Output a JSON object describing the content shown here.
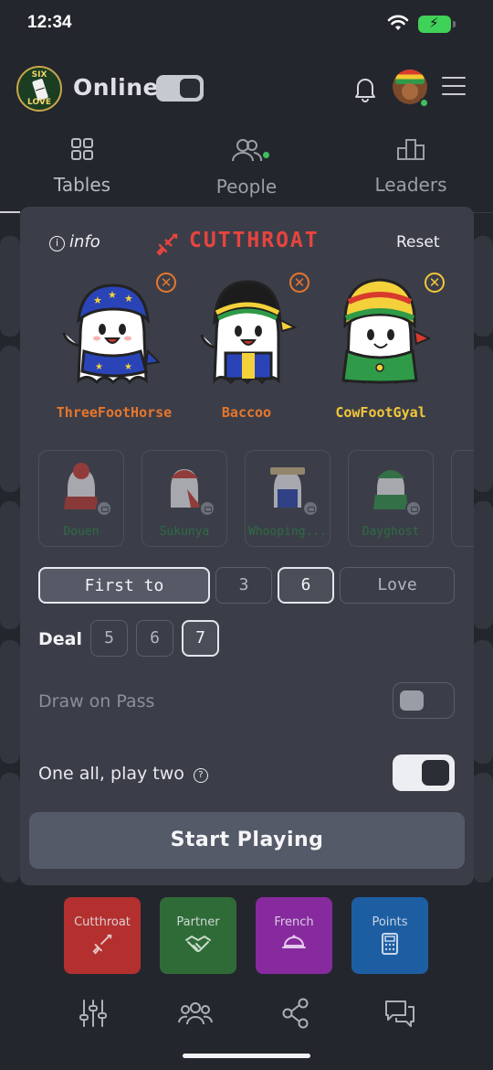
{
  "status_bar": {
    "time": "12:34"
  },
  "header": {
    "logo_top": "SIX",
    "logo_bottom": "LOVE",
    "online_label": "Online",
    "online_toggle_on": true
  },
  "tabs": [
    {
      "label": "Tables",
      "icon": "grid-icon"
    },
    {
      "label": "People",
      "icon": "people-icon",
      "has_dot": true
    },
    {
      "label": "Leaders",
      "icon": "podium-icon"
    }
  ],
  "panel": {
    "info_label": "info",
    "title": "CUTTHROAT",
    "reset_label": "Reset",
    "players": [
      {
        "name": "ThreeFootHorse",
        "color": "#e8762a"
      },
      {
        "name": "Baccoo",
        "color": "#e8762a"
      },
      {
        "name": "CowFootGyal",
        "color": "#f2c73a"
      }
    ],
    "locked_characters": [
      "Douen",
      "Sukunya",
      "Whooping...",
      "Dayghost"
    ],
    "first_to": {
      "label": "First to",
      "options": [
        "3",
        "6",
        "Love"
      ],
      "selected": "6"
    },
    "deal": {
      "label": "Deal",
      "options": [
        "5",
        "6",
        "7"
      ],
      "selected": "7"
    },
    "draw_on_pass": {
      "label": "Draw on Pass",
      "enabled": false
    },
    "one_all_play_two": {
      "label": "One all, play two",
      "enabled": true
    },
    "start_label": "Start Playing"
  },
  "modes": [
    {
      "label": "Cutthroat",
      "color": "#b3302f",
      "icon": "sword-icon"
    },
    {
      "label": "Partner",
      "color": "#2f6b37",
      "icon": "handshake-icon"
    },
    {
      "label": "French",
      "color": "#862a9e",
      "icon": "cloche-icon"
    },
    {
      "label": "Points",
      "color": "#1d5ea3",
      "icon": "calculator-icon"
    }
  ],
  "bottom_nav": [
    "sliders-icon",
    "group-icon",
    "share-icon",
    "chat-icon"
  ]
}
